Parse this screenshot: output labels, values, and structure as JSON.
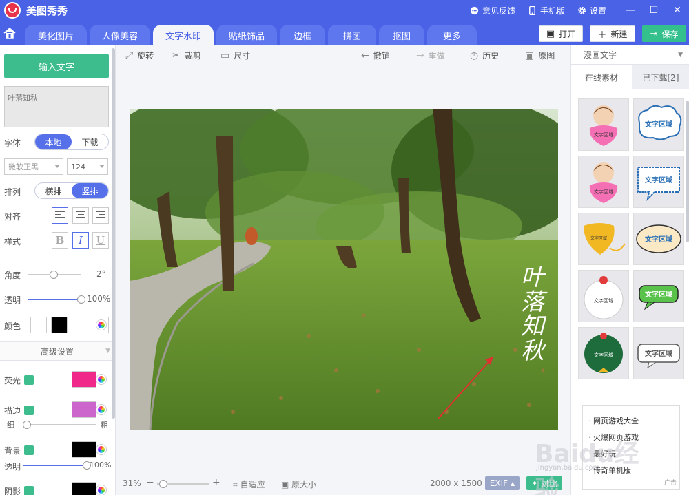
{
  "app": {
    "title": "美图秀秀"
  },
  "titlebar": {
    "feedback": "意见反馈",
    "mobile": "手机版",
    "settings": "设置"
  },
  "tabs": [
    "美化图片",
    "人像美容",
    "文字水印",
    "贴纸饰品",
    "边框",
    "拼图",
    "抠图",
    "更多"
  ],
  "active_tab": "文字水印",
  "actions": {
    "open": "打开",
    "new": "新建",
    "save": "保存"
  },
  "left": {
    "input_text_button": "输入文字",
    "text_value": "叶落知秋",
    "font_label": "字体",
    "font_source_local": "本地",
    "font_source_download": "下载",
    "font_name": "微软正黑",
    "font_size": "124",
    "arrange_label": "排列",
    "arrange_horizontal": "横排",
    "arrange_vertical": "竖排",
    "align_label": "对齐",
    "style_label": "样式",
    "style_bold": "B",
    "style_italic": "I",
    "style_underline": "U",
    "angle_label": "角度",
    "angle_value": "2°",
    "angle_level": 0.49,
    "opacity_label": "透明",
    "opacity_value": "100%",
    "opacity_level": 1.0,
    "color_label": "颜色",
    "advanced_label": "高级设置",
    "glow_label": "荧光",
    "glow_color": "#f0288a",
    "stroke_label": "描边",
    "stroke_color": "#cc66cc",
    "stroke_thin": "细",
    "stroke_thick": "粗",
    "stroke_level": 0.05,
    "bg_label": "背景",
    "bg_opacity_label": "透明",
    "bg_opacity_value": "100%",
    "bg_opacity_level": 1.0,
    "shadow_label": "阴影"
  },
  "toolbar": {
    "rotate": "旋转",
    "crop": "裁剪",
    "size": "尺寸",
    "undo": "撤销",
    "redo": "重做",
    "history": "历史",
    "original": "原图"
  },
  "canvas": {
    "overlay_text": [
      "叶",
      "落",
      "知",
      "秋"
    ]
  },
  "status": {
    "zoom": "31%",
    "zoom_level": 0.12,
    "fit": "自适应",
    "original_size": "原大小",
    "dimensions": "2000 x 1500",
    "exif": "EXIF",
    "compare": "对比"
  },
  "right": {
    "category": "漫画文字",
    "tab_online": "在线素材",
    "tab_downloaded": "已下载[2]",
    "thumb_text": "文字区域",
    "ad_items": [
      "网页游戏大全",
      "火爆网页游戏",
      "最好玩",
      "传奇单机版"
    ],
    "ad_tag": "广告"
  },
  "watermark": {
    "brand": "Baidu经验",
    "url": "jingyan.baidu.com"
  },
  "colors": {
    "accent": "#4a63e6",
    "green": "#3dbd8e"
  }
}
